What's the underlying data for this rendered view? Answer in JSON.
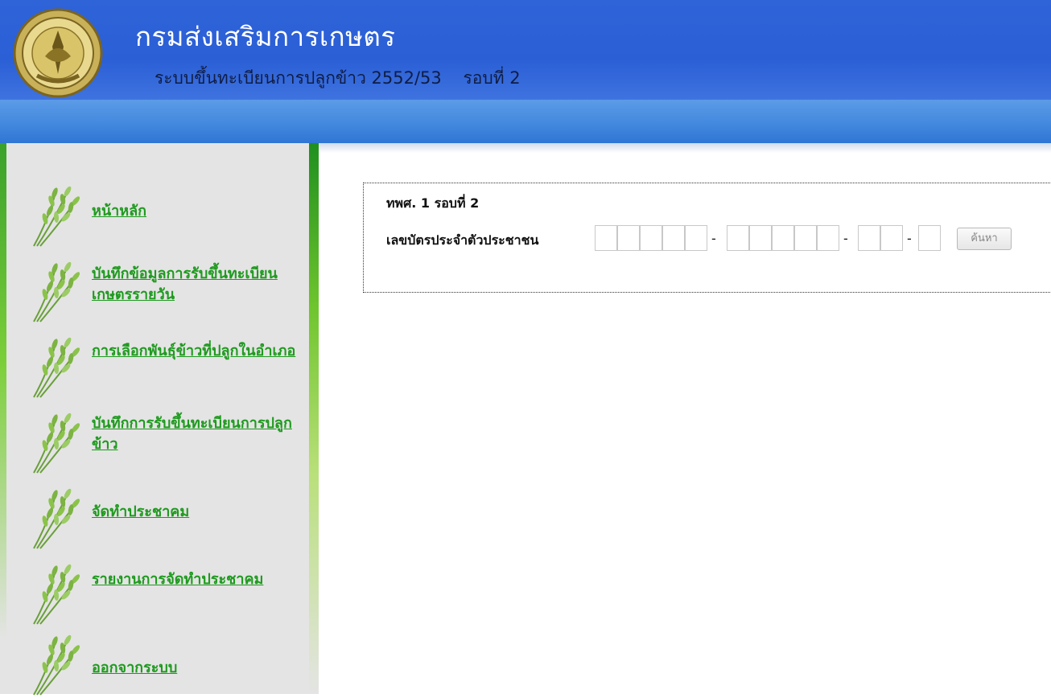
{
  "header": {
    "department_title": "กรมส่งเสริมการเกษตร",
    "system_title": "ระบบขึ้นทะเบียนการปลูกข้าว 2552/53    รอบที่ 2"
  },
  "sidebar": {
    "items": [
      {
        "label": "หน้าหลัก"
      },
      {
        "label": "บันทึกข้อมูลการรับขึ้นทะเบียนเกษตรรายวัน"
      },
      {
        "label": "การเลือกพันธุ์ข้าวที่ปลูกในอำเภอ"
      },
      {
        "label": "บันทึกการรับขึ้นทะเบียนการปลูกข้าว"
      },
      {
        "label": "จัดทำประชาคม"
      },
      {
        "label": "รายงานการจัดทำประชาคม"
      },
      {
        "label": "ออกจากระบบ"
      }
    ]
  },
  "main": {
    "section_title": "ทพศ. 1 รอบที่ 2",
    "id_label": "เลขบัตรประจำตัวประชาชน",
    "separator": "-",
    "search_label": "ค้นหา"
  },
  "colors": {
    "header_blue": "#2f63d8",
    "link_green": "#1f9a1f",
    "sidebar_gray": "#e4e4e4"
  }
}
